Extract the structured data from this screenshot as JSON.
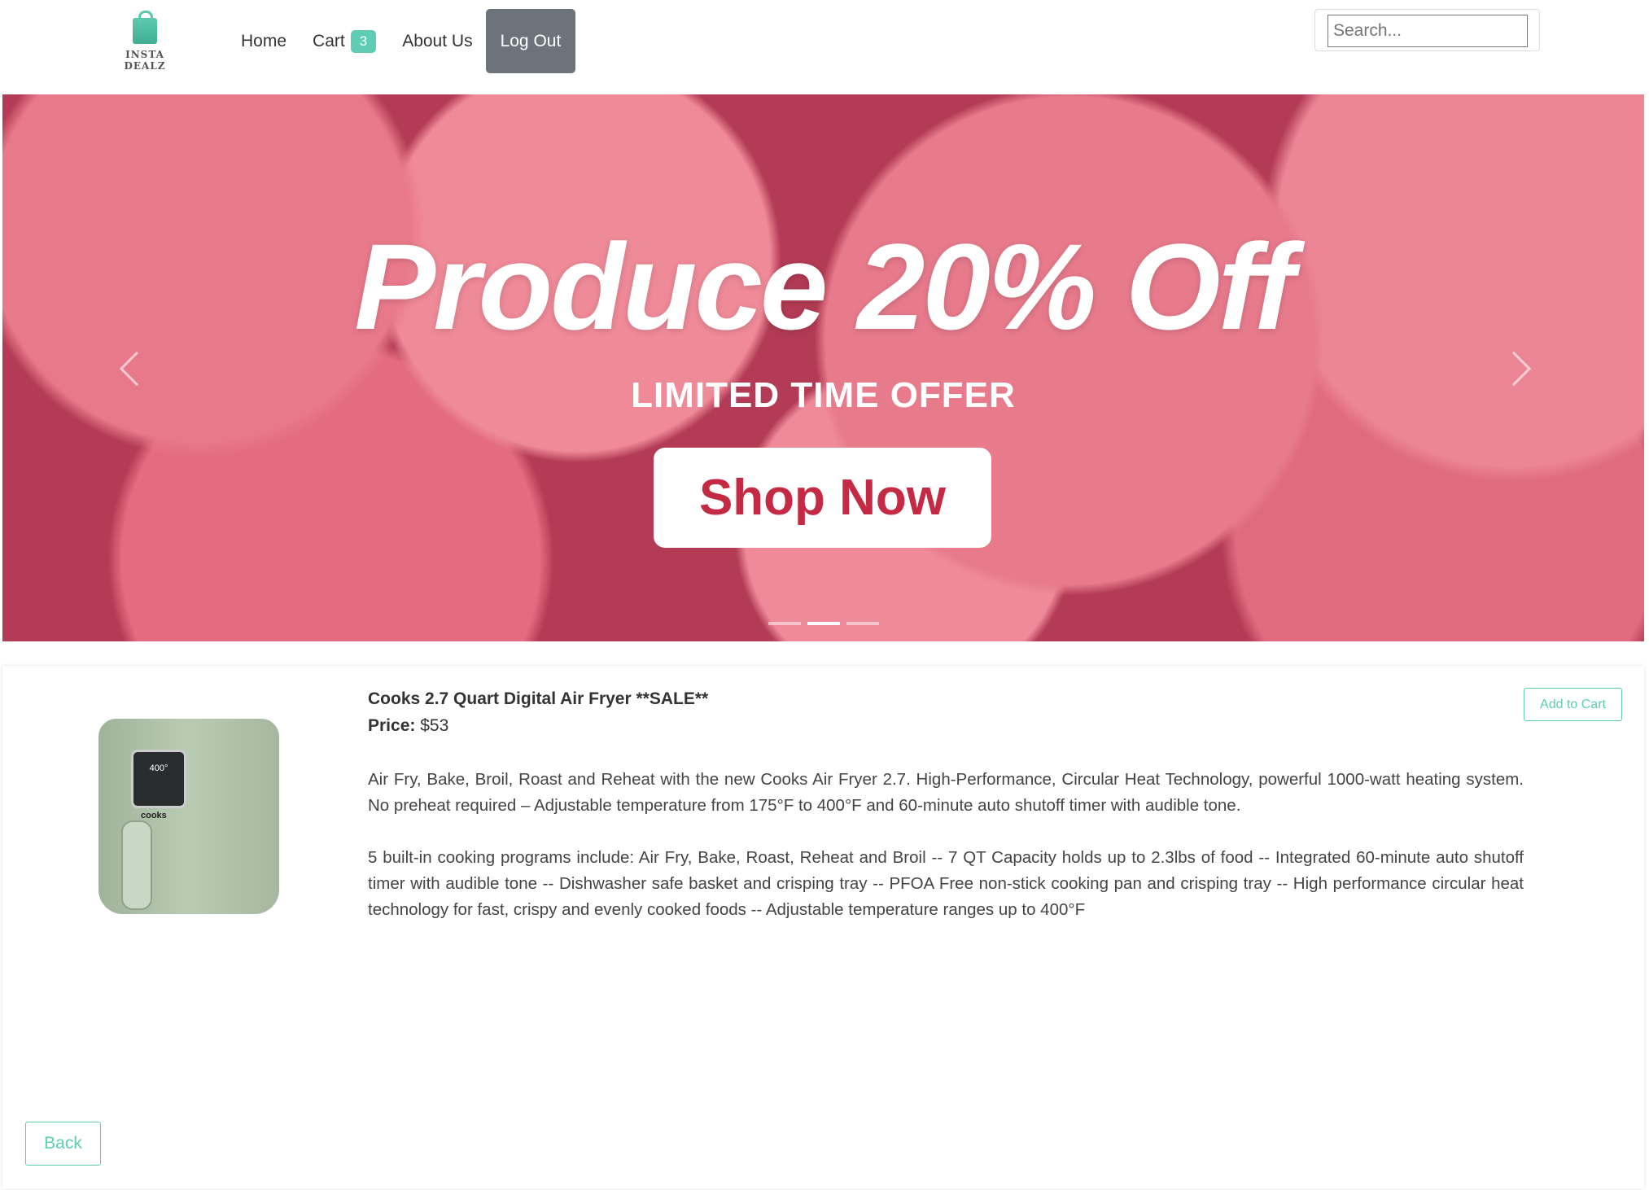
{
  "header": {
    "logo_text": "INSTA DEALZ",
    "nav": {
      "home": "Home",
      "cart": "Cart",
      "cart_count": "3",
      "about": "About Us",
      "logout": "Log Out"
    },
    "search_placeholder": "Search..."
  },
  "banner": {
    "headline": "Produce 20% Off",
    "subheadline": "LIMITED TIME OFFER",
    "cta": "Shop Now",
    "active_slide": 2,
    "slide_count": 3
  },
  "product": {
    "title": "Cooks 2.7 Quart Digital Air Fryer **SALE**",
    "price_label": "Price:",
    "price": "$53",
    "image_display": "400°",
    "image_brand": "cooks",
    "description": [
      "Air Fry, Bake, Broil, Roast and Reheat with the new Cooks Air Fryer 2.7. High-Performance, Circular Heat Technology, powerful 1000-watt heating system. No preheat required – Adjustable temperature from 175°F to 400°F and 60-minute auto shutoff timer with audible tone.",
      "5 built-in cooking programs include: Air Fry, Bake, Roast, Reheat and Broil -- 7 QT Capacity holds up to 2.3lbs of food -- Integrated 60-minute auto shutoff timer with audible tone -- Dishwasher safe basket and crisping tray -- PFOA Free non-stick cooking pan and crisping tray -- High performance circular heat technology for fast, crispy and evenly cooked foods -- Adjustable temperature ranges up to 400°F"
    ],
    "add_to_cart": "Add to Cart"
  },
  "back_label": "Back",
  "colors": {
    "accent": "#5ecdb3",
    "logout_bg": "#6c737b",
    "cta_text": "#c42a43"
  }
}
